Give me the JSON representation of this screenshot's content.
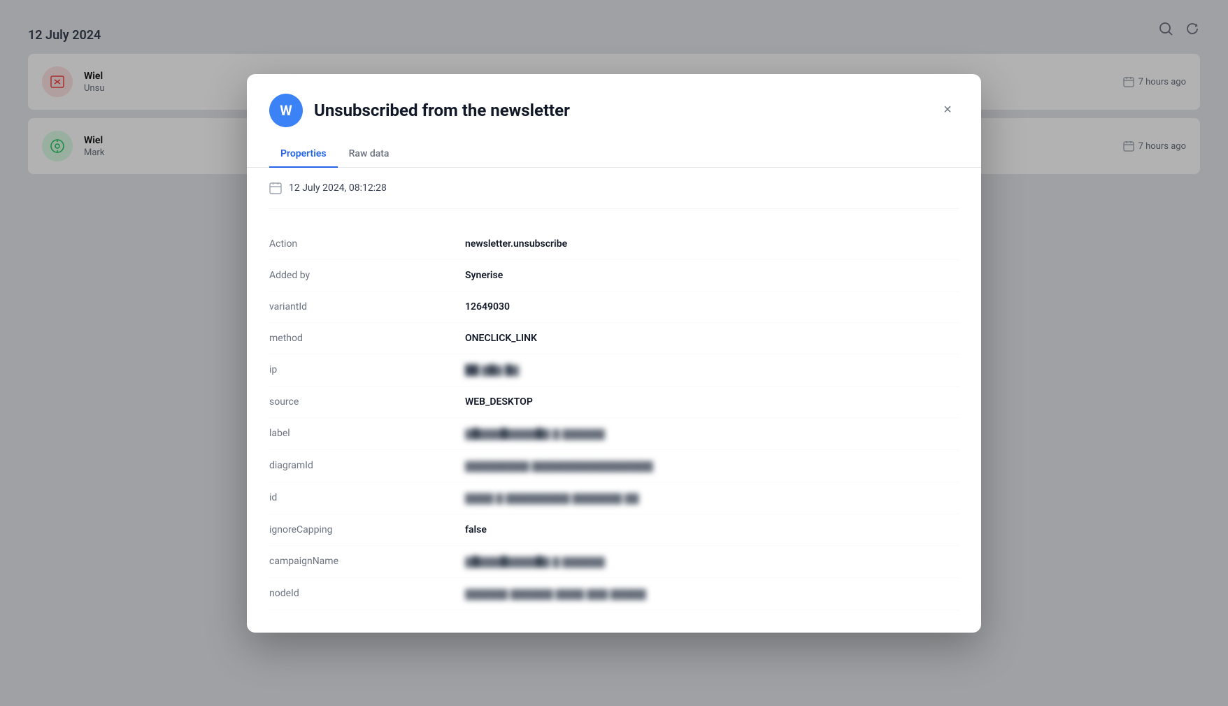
{
  "background": {
    "date_label": "12 July 2024",
    "rows": [
      {
        "name": "Wiel",
        "sub": "Unsu",
        "icon_type": "red",
        "time": "7 hours ago"
      },
      {
        "name": "Wiel",
        "sub": "Mark",
        "icon_type": "green",
        "time": "7 hours ago"
      }
    ]
  },
  "modal": {
    "avatar_letter": "W",
    "title": "Unsubscribed from the newsletter",
    "tabs": [
      {
        "id": "properties",
        "label": "Properties",
        "active": true
      },
      {
        "id": "raw-data",
        "label": "Raw data",
        "active": false
      }
    ],
    "timestamp": "12 July 2024, 08:12:28",
    "close_label": "×",
    "properties": [
      {
        "key": "Action",
        "value": "newsletter.unsubscribe",
        "blurred": false
      },
      {
        "key": "Added by",
        "value": "Synerise",
        "blurred": false
      },
      {
        "key": "variantId",
        "value": "12649030",
        "blurred": false
      },
      {
        "key": "method",
        "value": "ONECLICK_LINK",
        "blurred": false
      },
      {
        "key": "ip",
        "value": "██ ▓█▓ █▓",
        "blurred": true
      },
      {
        "key": "source",
        "value": "WEB_DESKTOP",
        "blurred": false
      },
      {
        "key": "label",
        "value": "▓█▓▓▓█▓▓▓▓█▓ ▓ ▓▓▓▓▓▓",
        "blurred": true
      },
      {
        "key": "diagramId",
        "value": "▓▓▓▓▓▓▓▓▓ ▓▓▓▓▓▓▓▓▓▓▓▓▓▓▓▓▓",
        "blurred": true
      },
      {
        "key": "id",
        "value": "▓▓▓▓ ▓ ▓▓▓▓▓▓▓▓▓ ▓▓▓▓▓▓▓ ▓▓",
        "blurred": true
      },
      {
        "key": "ignoreCapping",
        "value": "false",
        "blurred": false
      },
      {
        "key": "campaignName",
        "value": "▓█▓▓▓█▓▓▓▓█▓ ▓ ▓▓▓▓▓▓",
        "blurred": true
      },
      {
        "key": "nodeId",
        "value": "▓▓▓▓▓▓ ▓▓▓▓▓▓ ▓▓▓▓ ▓▓▓ ▓▓▓▓▓",
        "blurred": true
      }
    ]
  }
}
